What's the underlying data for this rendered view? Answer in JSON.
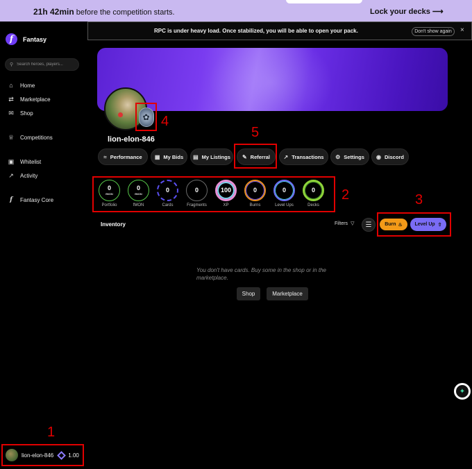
{
  "topbar": {
    "countdown_time": "21h 42min",
    "countdown_suffix": "before the competition starts.",
    "lock_decks": "Lock your decks ⟶"
  },
  "sidebar": {
    "brand": "Fantasy",
    "search_placeholder": "Search heroes, players...",
    "nav": [
      {
        "label": "Home",
        "icon": "home-icon"
      },
      {
        "label": "Marketplace",
        "icon": "swap-icon"
      },
      {
        "label": "Shop",
        "icon": "mail-icon"
      },
      {
        "label": "Competitions",
        "icon": "trophy-icon"
      },
      {
        "label": "Whitelist",
        "icon": "gift-icon"
      },
      {
        "label": "Activity",
        "icon": "trend-icon"
      },
      {
        "label": "Fantasy Core",
        "icon": "fantasy-logo-icon"
      }
    ],
    "user": {
      "name": "lion-elon-846",
      "balance": "1.00"
    }
  },
  "notice": {
    "message": "RPC is under heavy load. Once stabilized, you will be able to open your pack.",
    "dismiss": "Don't show again",
    "close": "×"
  },
  "profile": {
    "username": "lion-elon-846"
  },
  "tabs": [
    "Performance",
    "My Bids",
    "My Listings",
    "Referral",
    "Transactions",
    "Settings",
    "Discord"
  ],
  "stats": [
    {
      "value": "0",
      "sub": "fMON",
      "label": "Portfolio"
    },
    {
      "value": "0",
      "sub": "fMON",
      "label": "fMON"
    },
    {
      "value": "0",
      "sub": "",
      "label": "Cards"
    },
    {
      "value": "0",
      "sub": "",
      "label": "Fragments"
    },
    {
      "value": "100",
      "sub": "",
      "label": "XP"
    },
    {
      "value": "0",
      "sub": "",
      "label": "Burns"
    },
    {
      "value": "0",
      "sub": "",
      "label": "Level Ups"
    },
    {
      "value": "0",
      "sub": "",
      "label": "Decks"
    }
  ],
  "inventory": {
    "title": "Inventory",
    "filters": "Filters",
    "burn": "Burn",
    "level_up": "Level Up",
    "empty_message": "You don't have cards. Buy some in the shop or in the marketplace.",
    "shop_button": "Shop",
    "marketplace_button": "Marketplace"
  },
  "annotations": [
    "1",
    "2",
    "3",
    "4",
    "5"
  ],
  "colors": {
    "accent": "#6f3cf5",
    "topbar_bg": "#c9b9f0",
    "annotation_red": "#e10000",
    "burn": "#f39a18",
    "level_up": "#7a6cf5"
  }
}
